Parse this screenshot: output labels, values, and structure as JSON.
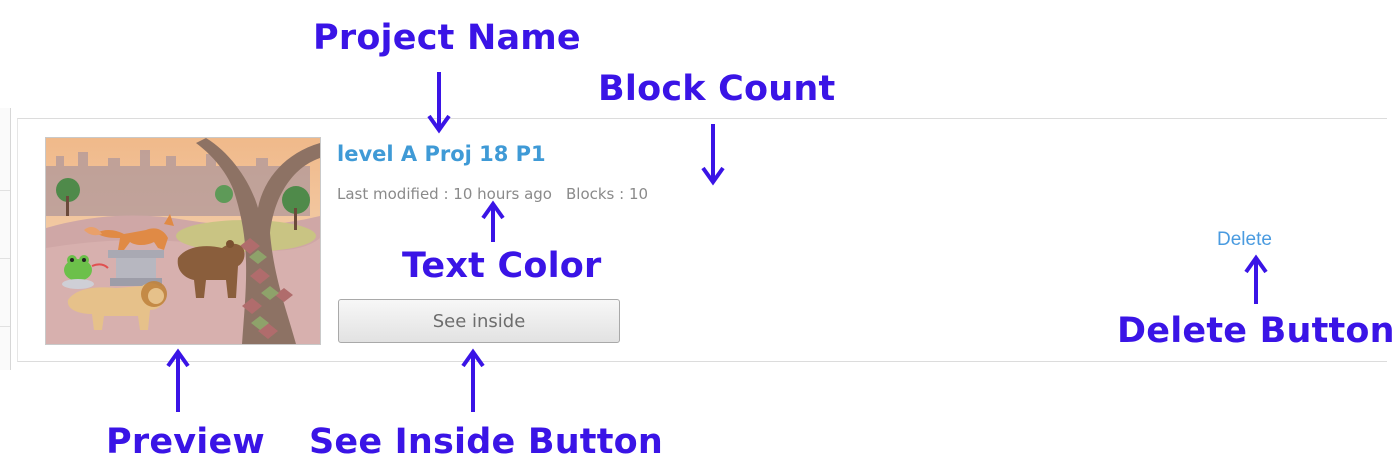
{
  "project": {
    "name": "level A Proj 18 P1",
    "last_modified_label": "Last modified :",
    "last_modified_value": "10 hours ago",
    "blocks_label": "Blocks :",
    "blocks_value": "10",
    "see_inside_label": "See inside",
    "delete_label": "Delete"
  },
  "annotations": {
    "project_name": "Project Name",
    "block_count": "Block Count",
    "text_color": "Text Color",
    "delete_button": "Delete Button",
    "preview": "Preview",
    "see_inside_button": "See Inside Button"
  },
  "colors": {
    "annotation": "#3a14e6",
    "project_name": "#3f9ad6",
    "meta_text": "#8a8a8a",
    "delete_link": "#4a9be0"
  }
}
